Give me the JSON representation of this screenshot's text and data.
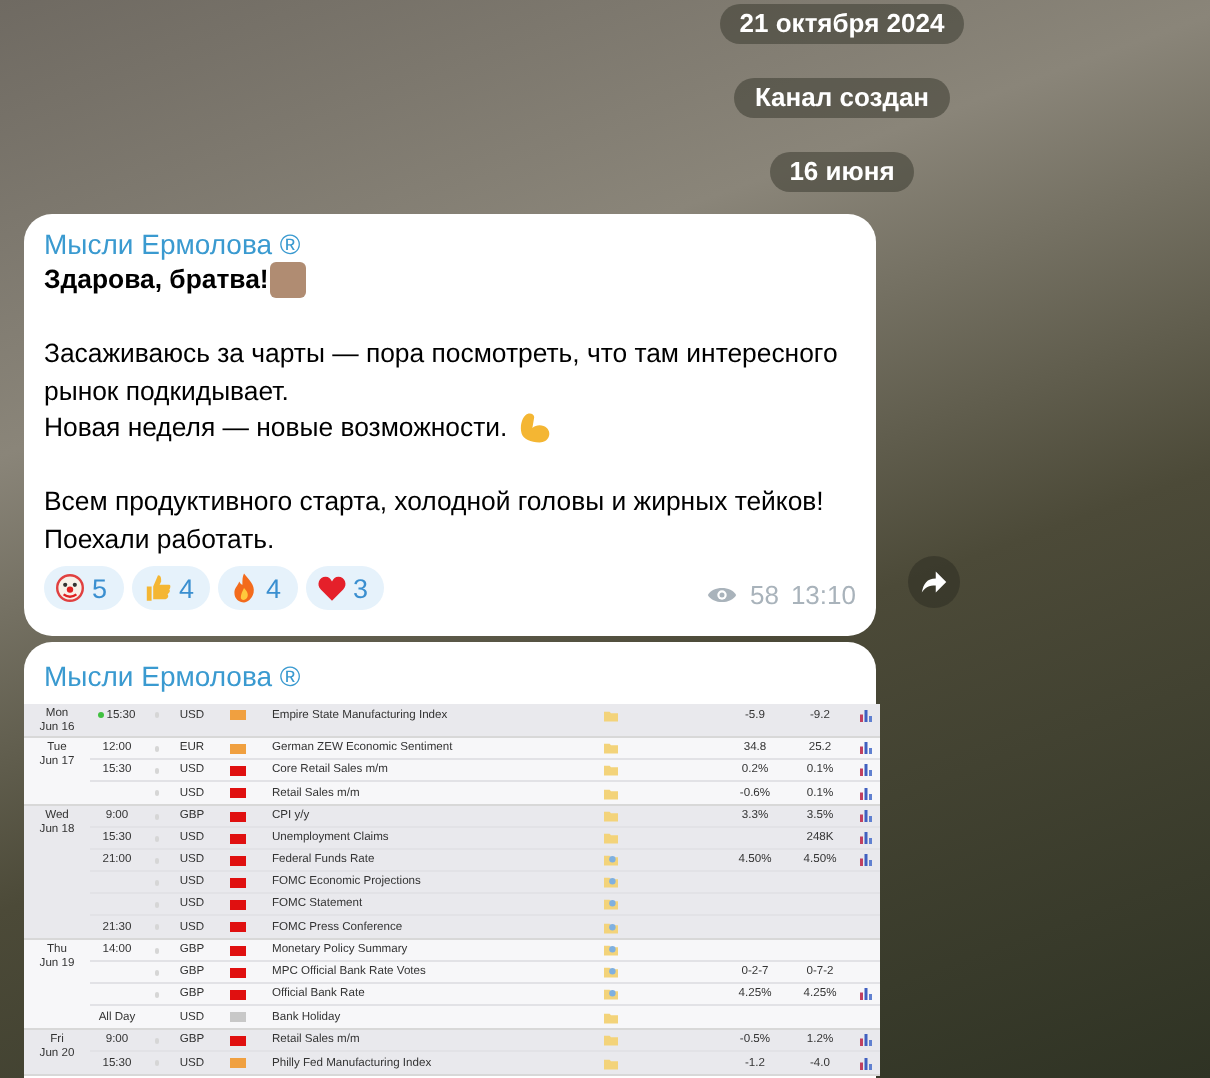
{
  "service_pills": [
    "21 октября 2024",
    "Канал создан",
    "16 июня"
  ],
  "post": {
    "channel": "Мысли Ермолова ®",
    "paragraphs": [
      {
        "lines": [
          {
            "text": "Здарова, братва!",
            "bold": true,
            "emoji": {
              "kind": "face"
            }
          }
        ]
      },
      {
        "lines": [
          {
            "text": "Засаживаюсь за чарты — пора посмотреть, что там интересного рынок подкидывает.",
            "bold": false
          },
          {
            "text": "Новая неделя — новые возможности.",
            "bold": false,
            "emoji": {
              "kind": "flexed-arm"
            }
          }
        ]
      },
      {
        "lines": [
          {
            "text": "Всем продуктивного старта, холодной головы и жирных тейков!",
            "bold": false
          },
          {
            "text": "Поехали работать.",
            "bold": false
          }
        ]
      }
    ],
    "reactions": [
      {
        "kind": "clown",
        "count": "5"
      },
      {
        "kind": "thumbs-up",
        "count": "4"
      },
      {
        "kind": "fire",
        "count": "4"
      },
      {
        "kind": "heart",
        "count": "3"
      }
    ],
    "views": "58",
    "time": "13:10"
  },
  "post2": {
    "channel": "Мысли Ермолова ®",
    "calendar": [
      {
        "day": "Mon",
        "date": "Jun 16",
        "events": [
          {
            "time": "15:30",
            "live": true,
            "alert": true,
            "currency": "USD",
            "color": "#f0a040",
            "event": "Empire State Manufacturing Index",
            "detail": {
              "kind": "folder"
            },
            "actual": "-5.9",
            "forecast": "-9.2",
            "chart": true
          }
        ]
      },
      {
        "day": "Tue",
        "date": "Jun 17",
        "events": [
          {
            "time": "12:00",
            "live": false,
            "alert": true,
            "currency": "EUR",
            "color": "#f0a040",
            "event": "German ZEW Economic Sentiment",
            "detail": {
              "kind": "folder"
            },
            "actual": "34.8",
            "forecast": "25.2",
            "chart": true
          },
          {
            "time": "15:30",
            "live": false,
            "alert": true,
            "currency": "USD",
            "color": "#e01010",
            "event": "Core Retail Sales m/m",
            "detail": {
              "kind": "folder"
            },
            "actual": "0.2%",
            "forecast": "0.1%",
            "chart": true
          },
          {
            "live": false,
            "alert": true,
            "currency": "USD",
            "color": "#e01010",
            "event": "Retail Sales m/m",
            "detail": {
              "kind": "folder"
            },
            "actual": "-0.6%",
            "forecast": "0.1%",
            "chart": true
          }
        ]
      },
      {
        "day": "Wed",
        "date": "Jun 18",
        "events": [
          {
            "time": "9:00",
            "live": false,
            "alert": true,
            "currency": "GBP",
            "color": "#e01010",
            "event": "CPI y/y",
            "detail": {
              "kind": "folder"
            },
            "actual": "3.3%",
            "forecast": "3.5%",
            "chart": true
          },
          {
            "time": "15:30",
            "live": false,
            "alert": true,
            "currency": "USD",
            "color": "#e01010",
            "event": "Unemployment Claims",
            "detail": {
              "kind": "folder"
            },
            "forecast": "248K",
            "chart": true
          },
          {
            "time": "21:00",
            "live": false,
            "alert": true,
            "currency": "USD",
            "color": "#e01010",
            "event": "Federal Funds Rate",
            "detail": {
              "kind": "speech"
            },
            "actual": "4.50%",
            "forecast": "4.50%",
            "chart": true
          },
          {
            "live": false,
            "alert": true,
            "currency": "USD",
            "color": "#e01010",
            "event": "FOMC Economic Projections",
            "detail": {
              "kind": "speech"
            },
            "chart": false
          },
          {
            "live": false,
            "alert": true,
            "currency": "USD",
            "color": "#e01010",
            "event": "FOMC Statement",
            "detail": {
              "kind": "speech"
            },
            "chart": false
          },
          {
            "time": "21:30",
            "live": false,
            "alert": true,
            "currency": "USD",
            "color": "#e01010",
            "event": "FOMC Press Conference",
            "detail": {
              "kind": "speech"
            },
            "chart": false
          }
        ]
      },
      {
        "day": "Thu",
        "date": "Jun 19",
        "events": [
          {
            "time": "14:00",
            "live": false,
            "alert": true,
            "currency": "GBP",
            "color": "#e01010",
            "event": "Monetary Policy Summary",
            "detail": {
              "kind": "speech"
            },
            "chart": false
          },
          {
            "live": false,
            "alert": true,
            "currency": "GBP",
            "color": "#e01010",
            "event": "MPC Official Bank Rate Votes",
            "detail": {
              "kind": "speech"
            },
            "actual": "0-2-7",
            "forecast": "0-7-2",
            "chart": false
          },
          {
            "live": false,
            "alert": true,
            "currency": "GBP",
            "color": "#e01010",
            "event": "Official Bank Rate",
            "detail": {
              "kind": "speech"
            },
            "actual": "4.25%",
            "forecast": "4.25%",
            "chart": true
          },
          {
            "time": "All Day",
            "live": false,
            "alert": false,
            "currency": "USD",
            "color": "#c8c8c8",
            "event": "Bank Holiday",
            "detail": {
              "kind": "folder"
            },
            "chart": false
          }
        ]
      },
      {
        "day": "Fri",
        "date": "Jun 20",
        "events": [
          {
            "time": "9:00",
            "live": false,
            "alert": true,
            "currency": "GBP",
            "color": "#e01010",
            "event": "Retail Sales m/m",
            "detail": {
              "kind": "folder"
            },
            "actual": "-0.5%",
            "forecast": "1.2%",
            "chart": true
          },
          {
            "time": "15:30",
            "live": false,
            "alert": true,
            "currency": "USD",
            "color": "#f0a040",
            "event": "Philly Fed Manufacturing Index",
            "detail": {
              "kind": "folder"
            },
            "actual": "-1.2",
            "forecast": "-4.0",
            "chart": true
          }
        ]
      }
    ]
  }
}
